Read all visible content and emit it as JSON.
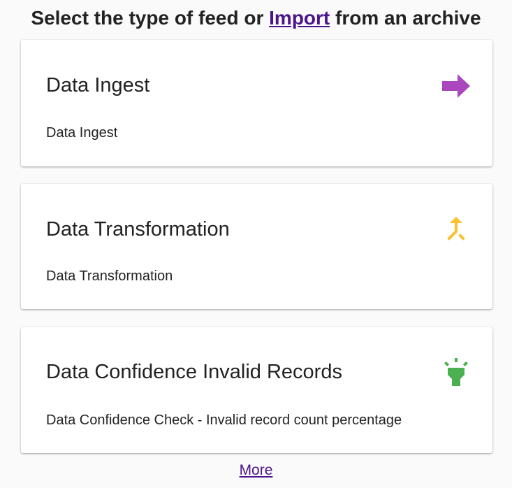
{
  "header": {
    "prefix": "Select the type of feed or",
    "import_link": "Import",
    "suffix": "from an archive"
  },
  "feeds": [
    {
      "title": "Data Ingest",
      "description": "Data Ingest",
      "icon": "arrow-right-icon",
      "color": "#ab47bc"
    },
    {
      "title": "Data Transformation",
      "description": "Data Transformation",
      "icon": "merge-icon",
      "color": "#fbc02d"
    },
    {
      "title": "Data Confidence Invalid Records",
      "description": "Data Confidence Check - Invalid record count percentage",
      "icon": "highlight-icon",
      "color": "#4caf50"
    }
  ],
  "footer": {
    "more_link": "More"
  }
}
